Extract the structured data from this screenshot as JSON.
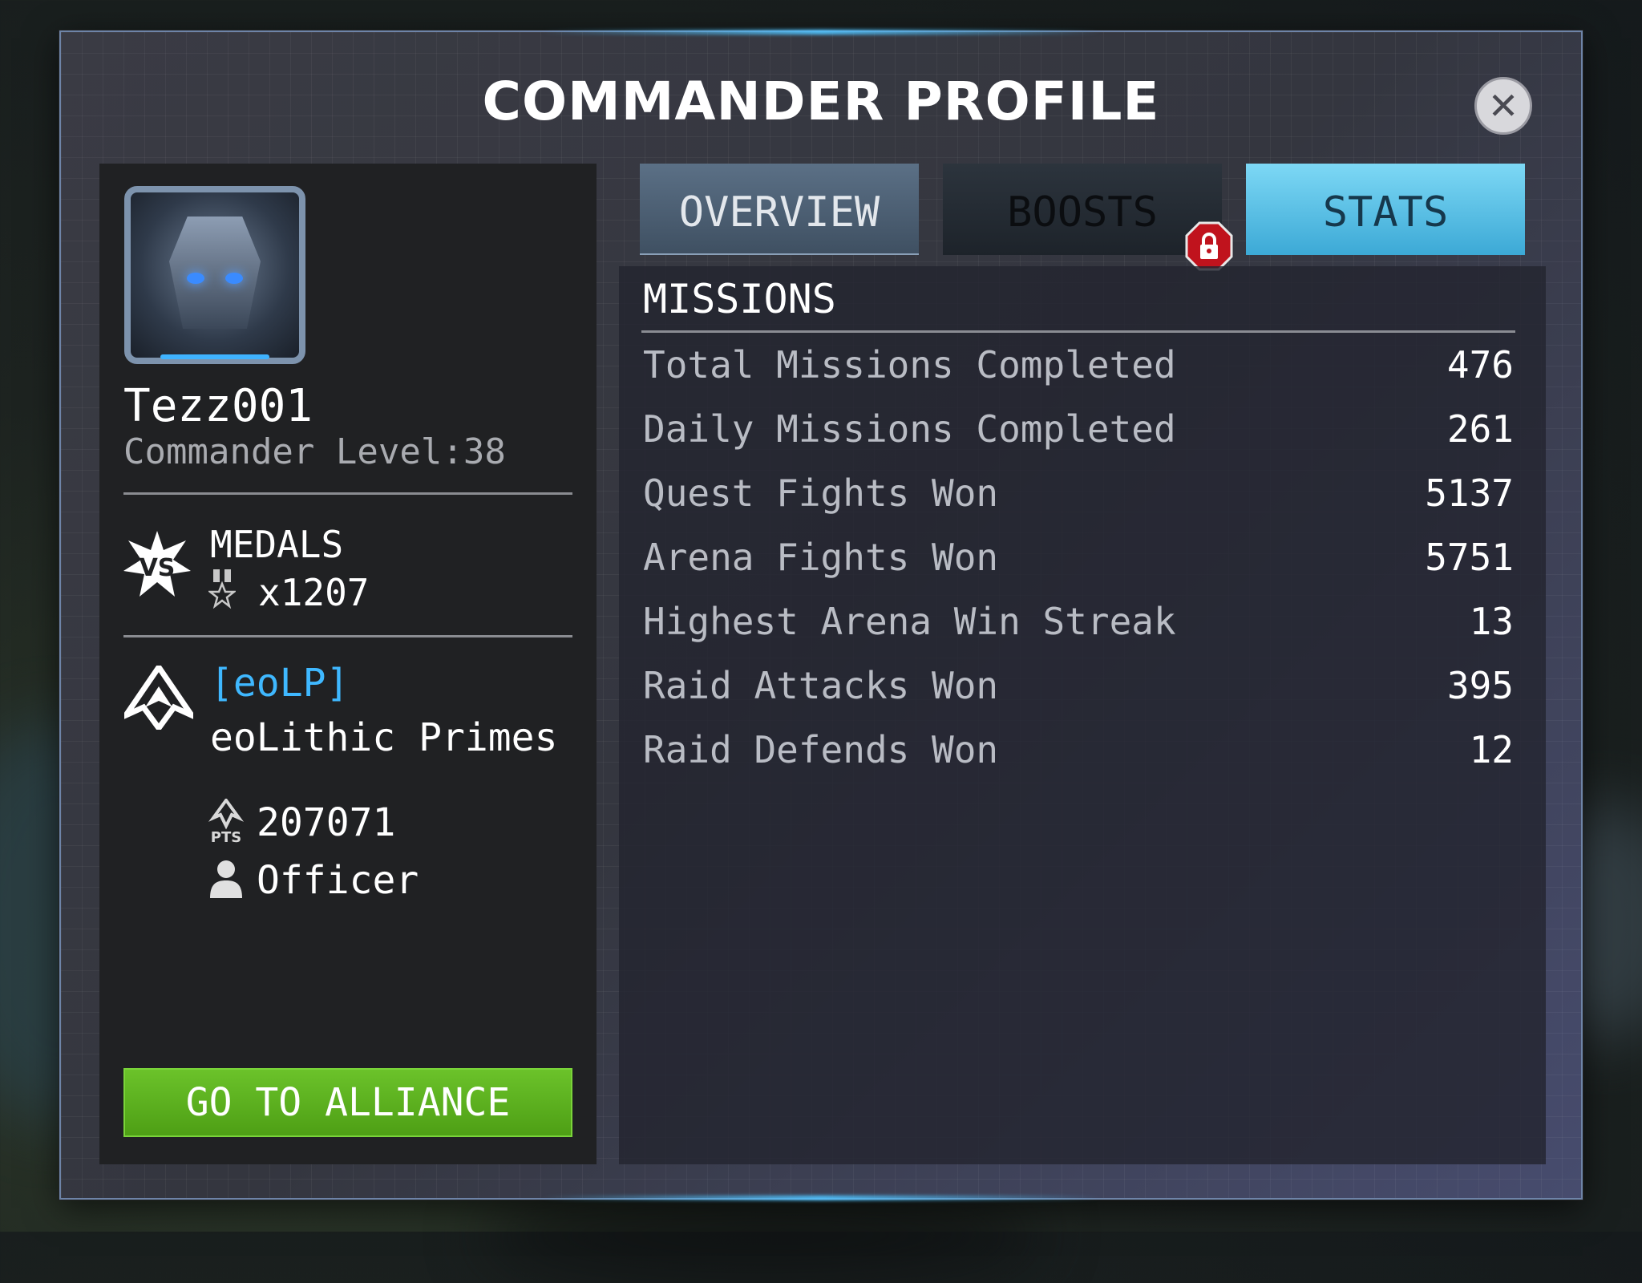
{
  "header": {
    "title": "COMMANDER PROFILE",
    "close_icon": "close-icon"
  },
  "profile": {
    "name": "Tezz001",
    "level_text": "Commander Level:38",
    "medals_label": "MEDALS",
    "medals_count": "x1207",
    "alliance_tag": "[eoLP]",
    "alliance_name": "eoLithic Primes",
    "alliance_points": "207071",
    "rank": "Officer",
    "alliance_button": "GO TO ALLIANCE"
  },
  "tabs": [
    {
      "label": "OVERVIEW",
      "state": "inactive"
    },
    {
      "label": "BOOSTS",
      "state": "locked"
    },
    {
      "label": "STATS",
      "state": "active"
    }
  ],
  "missions": {
    "title": "MISSIONS",
    "rows": [
      {
        "label": "Total Missions Completed",
        "value": "476"
      },
      {
        "label": "Daily Missions Completed",
        "value": "261"
      },
      {
        "label": "Quest Fights Won",
        "value": "5137"
      },
      {
        "label": "Arena Fights Won",
        "value": "5751"
      },
      {
        "label": "Highest Arena Win Streak",
        "value": "13"
      },
      {
        "label": "Raid Attacks Won",
        "value": "395"
      },
      {
        "label": "Raid Defends Won",
        "value": "12"
      }
    ]
  },
  "colors": {
    "accent": "#3fb8ff",
    "button_green": "#5cb11f",
    "active_tab": "#5cc4ea",
    "lock_red": "#c0131d"
  }
}
